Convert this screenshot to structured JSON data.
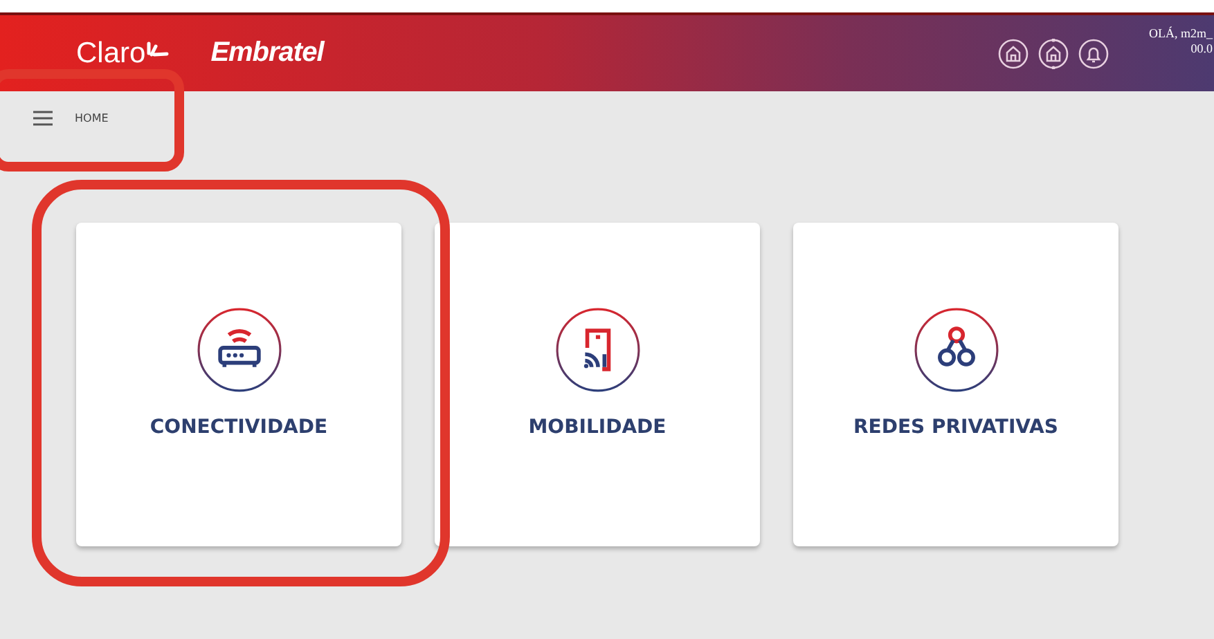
{
  "header": {
    "brand": "Claro",
    "partner": "Embratel",
    "user_greeting": "OLÁ, m2m_",
    "user_code": "00.0"
  },
  "breadcrumb": {
    "label": "HOME",
    "highlighted": true
  },
  "cards": [
    {
      "label": "CONECTIVIDADE",
      "kind": "router",
      "highlighted": true
    },
    {
      "label": "MOBILIDADE",
      "kind": "mobile",
      "highlighted": false
    },
    {
      "label": "REDES PRIVATIVAS",
      "kind": "network",
      "highlighted": false
    }
  ]
}
